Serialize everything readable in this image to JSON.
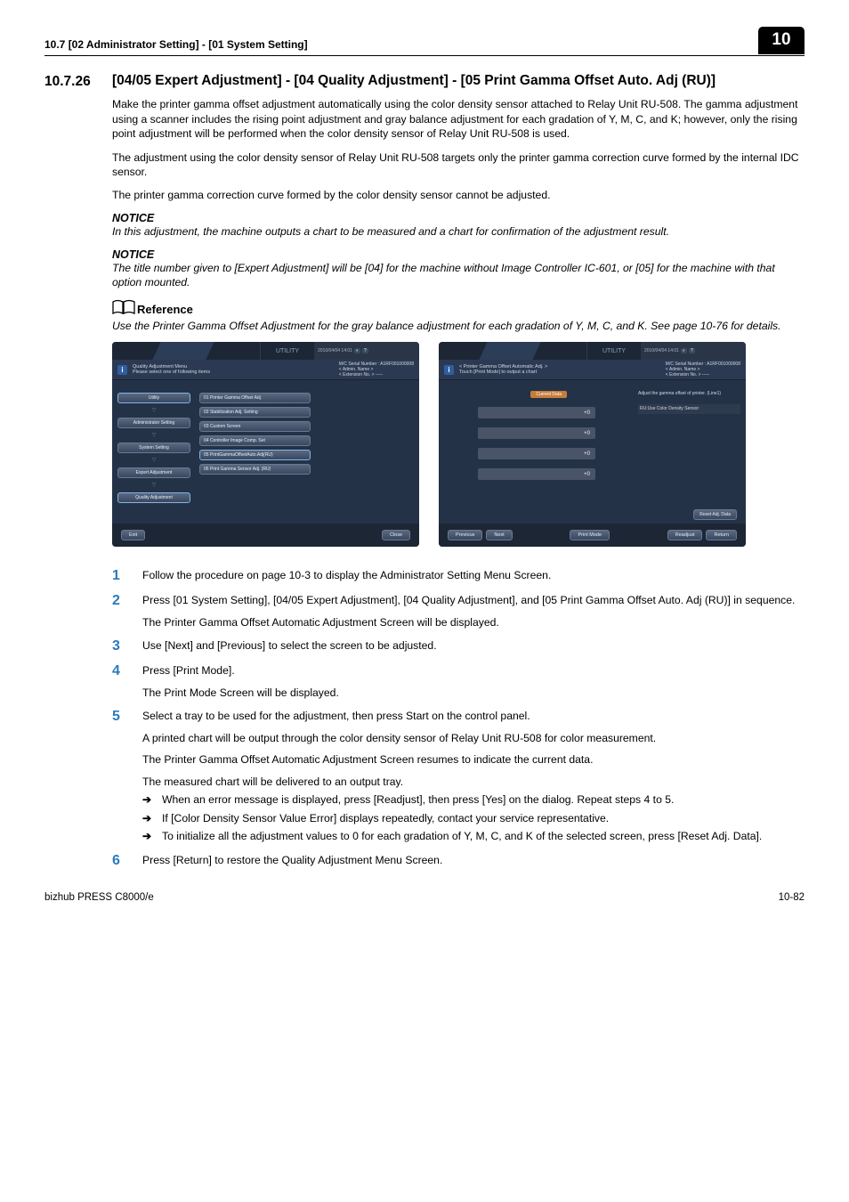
{
  "header": {
    "left": "10.7    [02 Administrator Setting] - [01 System Setting]",
    "right": "10"
  },
  "section": {
    "number": "10.7.26",
    "title": "[04/05 Expert Adjustment] - [04 Quality Adjustment] - [05 Print Gamma Offset Auto. Adj (RU)]"
  },
  "paragraphs": {
    "p1": "Make the printer gamma offset adjustment automatically using the color density sensor attached to Relay Unit RU-508. The gamma adjustment using a scanner includes the rising point adjustment and gray balance adjustment for each gradation of Y, M, C, and K; however, only the rising point adjustment will be performed when the color density sensor of Relay Unit RU-508 is used.",
    "p2": "The adjustment using the color density sensor of Relay Unit RU-508 targets only the printer gamma correction curve formed by the internal IDC sensor.",
    "p3": "The printer gamma correction curve formed by the color density sensor cannot be adjusted."
  },
  "notice1": {
    "head": "NOTICE",
    "body": "In this adjustment, the machine outputs a chart to be measured and a chart for confirmation of the adjustment result."
  },
  "notice2": {
    "head": "NOTICE",
    "body": "The title number given to [Expert Adjustment] will be [04] for the machine without Image Controller IC-601, or [05] for the machine with that option mounted."
  },
  "reference": {
    "head": "Reference",
    "body": "Use the Printer Gamma Offset Adjustment for the gray balance adjustment for each gradation of Y, M, C, and K. See page 10-76 for details."
  },
  "screenshotLeft": {
    "topCenter": "UTILITY",
    "dt": "2010/04/04 14:01",
    "serial": "M/C Serial Number : A1RF001000008",
    "admin": "< Admin. Name >",
    "ext": "< Extension No. > -----",
    "subLine1": "Quality Adjustment Menu",
    "subLine2": "Please select one of following items",
    "crumbs": [
      "Utility",
      "Administrator Setting",
      "System Setting",
      "Expert Adjustment",
      "Quality Adjustment"
    ],
    "options": [
      "01 Printer Gamma Offset Adj.",
      "02 Stabilization Adj. Setting",
      "03 Custom Screen",
      "04 Controller Image Comp. Set",
      "05 PrintGammaOffsetAuto.Adj(RU)",
      "06 Print Gamma Sensor Adj. (RU)"
    ],
    "exit": "Exit",
    "close": "Close"
  },
  "screenshotRight": {
    "topCenter": "UTILITY",
    "dt": "2010/04/04 14:01",
    "serial": "M/C Serial Number : A1RF001000008",
    "admin": "< Admin. Name >",
    "ext": "< Extension No. > -----",
    "subLine1": "< Printer Gamma Offset Automatic Adj. >",
    "subLine2": "Touch [Print Mode] to output a chart",
    "currentData": "Current Data",
    "val": "+0",
    "adjustText": "Adjust the gamma offset of printer. (Line1)",
    "useSensor": "RU:Use Color Density Sensor",
    "reset": "Reset Adj. Data",
    "previous": "Previous",
    "next": "Next",
    "printMode": "Print Mode",
    "readjust": "Readjust",
    "ret": "Return"
  },
  "steps": {
    "s1": "Follow the procedure on page 10-3 to display the Administrator Setting Menu Screen.",
    "s2": "Press [01 System Setting], [04/05 Expert Adjustment], [04 Quality Adjustment], and [05 Print Gamma Offset Auto. Adj (RU)] in sequence.",
    "s2b": "The Printer Gamma Offset Automatic Adjustment Screen will be displayed.",
    "s3": "Use [Next] and [Previous] to select the screen to be adjusted.",
    "s4": "Press [Print Mode].",
    "s4b": "The Print Mode Screen will be displayed.",
    "s5": "Select a tray to be used for the adjustment, then press Start on the control panel.",
    "s5b": "A printed chart will be output through the color density sensor of Relay Unit RU-508 for color measurement.",
    "s5c": "The Printer Gamma Offset Automatic Adjustment Screen resumes to indicate the current data.",
    "s5d": "The measured chart will be delivered to an output tray.",
    "s5e": "When an error message is displayed, press [Readjust], then press [Yes] on the dialog. Repeat steps 4 to 5.",
    "s5f": "If [Color Density Sensor Value Error] displays repeatedly, contact your service representative.",
    "s5g": "To initialize all the adjustment values to 0 for each gradation of Y, M, C, and K of the selected screen, press [Reset Adj. Data].",
    "s6": "Press [Return] to restore the Quality Adjustment Menu Screen."
  },
  "footer": {
    "left": "bizhub PRESS C8000/e",
    "right": "10-82"
  }
}
